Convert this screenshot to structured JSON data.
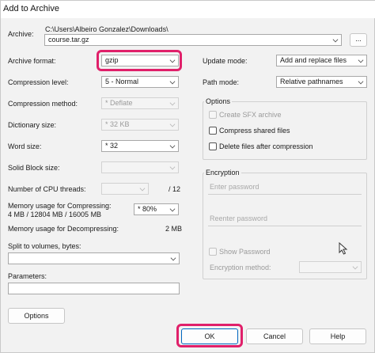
{
  "window": {
    "title": "Add to Archive"
  },
  "archive": {
    "label": "Archive:",
    "path": "C:\\Users\\Albeiro Gonzalez\\Downloads\\",
    "filename": "course.tar.gz",
    "browse_label": "..."
  },
  "left": {
    "archive_format": {
      "label": "Archive format:",
      "value": "gzip"
    },
    "compression_level": {
      "label": "Compression level:",
      "value": "5 - Normal"
    },
    "compression_method": {
      "label": "Compression method:",
      "value": "* Deflate"
    },
    "dictionary_size": {
      "label": "Dictionary size:",
      "value": "* 32 KB"
    },
    "word_size": {
      "label": "Word size:",
      "value": "* 32"
    },
    "solid_block_size": {
      "label": "Solid Block size:",
      "value": ""
    },
    "cpu_threads": {
      "label": "Number of CPU threads:",
      "value": "",
      "total": "/ 12"
    },
    "memory_compress": {
      "label": "Memory usage for Compressing:",
      "detail": "4 MB / 12804 MB / 16005 MB",
      "value": "* 80%"
    },
    "memory_decompress": {
      "label": "Memory usage for Decompressing:",
      "value": "2 MB"
    },
    "split": {
      "label": "Split to volumes, bytes:",
      "value": ""
    },
    "parameters": {
      "label": "Parameters:",
      "value": ""
    },
    "options_button": "Options"
  },
  "right": {
    "update_mode": {
      "label": "Update mode:",
      "value": "Add and replace files"
    },
    "path_mode": {
      "label": "Path mode:",
      "value": "Relative pathnames"
    },
    "options_group": {
      "title": "Options",
      "create_sfx": "Create SFX archive",
      "compress_shared": "Compress shared files",
      "delete_after": "Delete files after compression"
    },
    "encryption_group": {
      "title": "Encryption",
      "enter_password": "Enter password",
      "reenter_password": "Reenter password",
      "show_password": "Show Password",
      "method_label": "Encryption method:",
      "method_value": ""
    }
  },
  "footer": {
    "ok": "OK",
    "cancel": "Cancel",
    "help": "Help"
  },
  "colors": {
    "highlight": "#e0206a",
    "accent": "#0067c0"
  }
}
